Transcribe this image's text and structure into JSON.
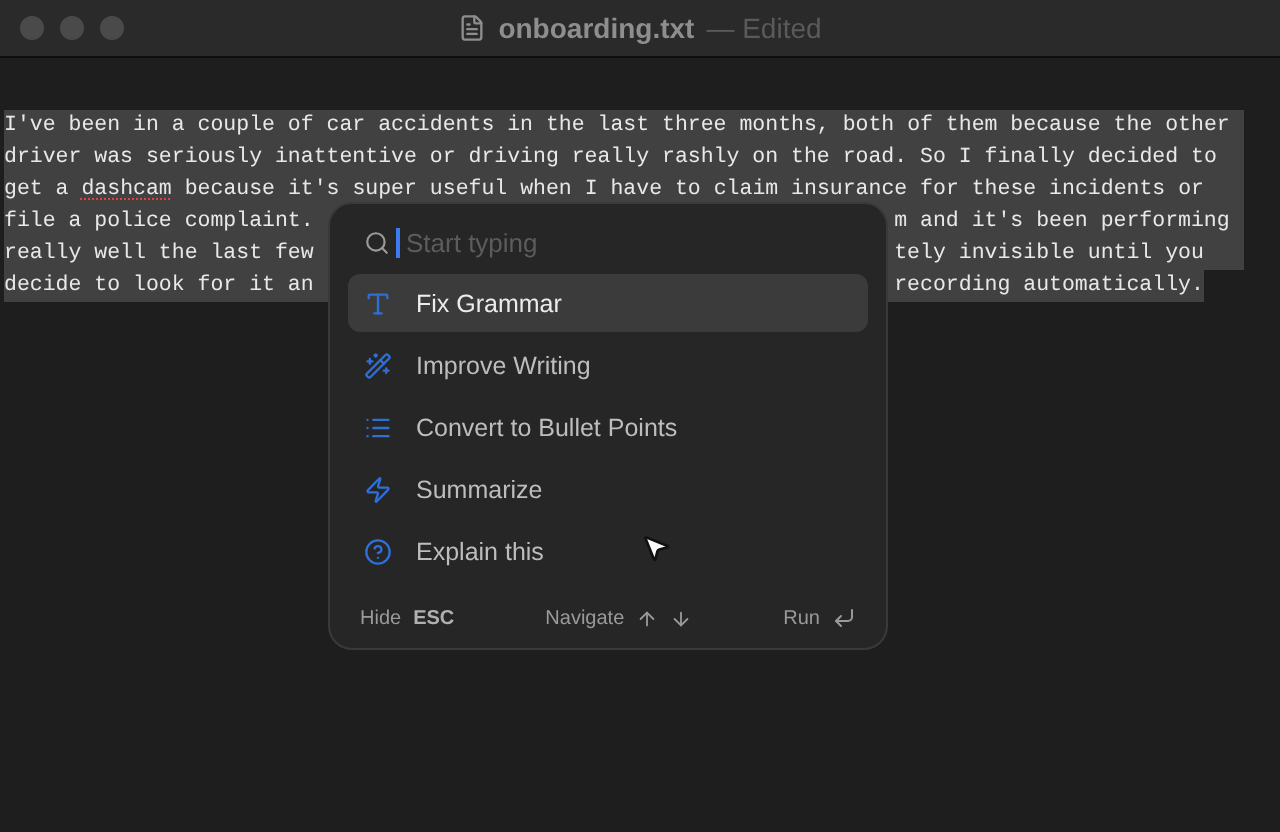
{
  "window": {
    "title": "onboarding.txt",
    "status": "— Edited"
  },
  "document": {
    "lines": [
      {
        "left": [
          {
            "text": "I've been in a couple of car accidents in the last three months, both of them because the other"
          }
        ]
      },
      {
        "left": [
          {
            "text": "driver was seriously inattentive or driving really rashly on the road. So I finally decided to"
          }
        ]
      },
      {
        "left": [
          {
            "text": "get a "
          },
          {
            "text": "dashcam",
            "misspelled": true
          },
          {
            "text": " because it's super useful when I have to claim insurance for these incidents or"
          }
        ]
      },
      {
        "left": [
          {
            "text": "file a police complaint."
          }
        ],
        "right": "m and it's been performing"
      },
      {
        "left": [
          {
            "text": "really well the last few"
          }
        ],
        "right": "tely invisible until you"
      },
      {
        "left": [
          {
            "text": "decide to look for it an"
          }
        ],
        "right": "recording automatically."
      }
    ]
  },
  "popup": {
    "search": {
      "placeholder": "Start typing"
    },
    "items": [
      {
        "kind": "grammar",
        "label": "Fix Grammar",
        "selected": true
      },
      {
        "kind": "writing",
        "label": "Improve Writing",
        "selected": false
      },
      {
        "kind": "bullets",
        "label": "Convert to Bullet Points",
        "selected": false
      },
      {
        "kind": "summary",
        "label": "Summarize",
        "selected": false
      },
      {
        "kind": "explain",
        "label": "Explain this",
        "selected": false
      }
    ],
    "footer": {
      "hide": "Hide",
      "hide_key": "ESC",
      "navigate": "Navigate",
      "run": "Run"
    }
  }
}
